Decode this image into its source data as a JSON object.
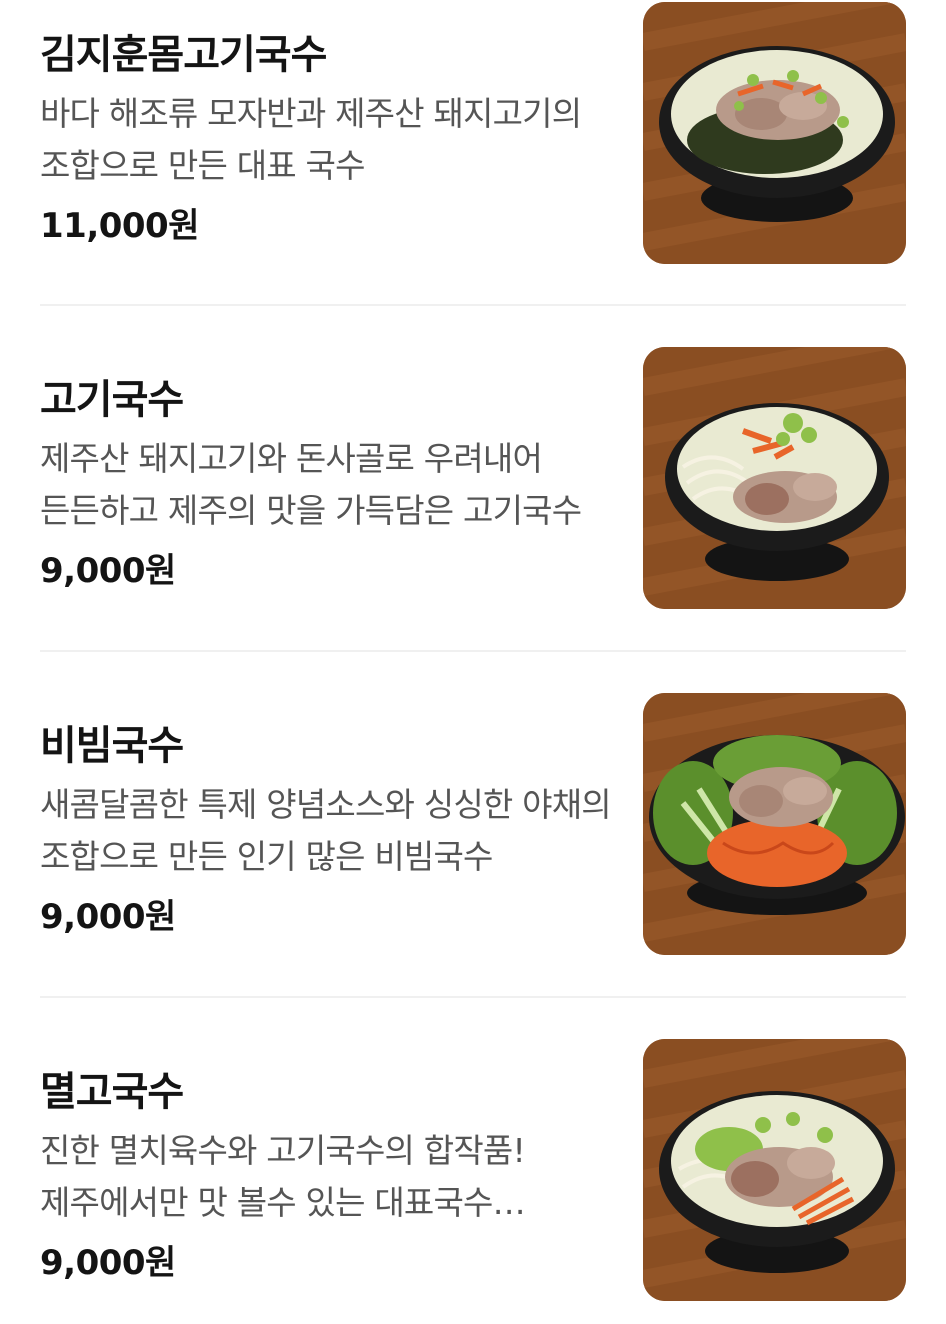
{
  "menu": {
    "items": [
      {
        "name": "김지훈몸고기국수",
        "description": "바다 해조류 모자반과 제주산 돼지고기의 조합으로 만든 대표 국수",
        "price": "11,000원",
        "image": "momguksu-photo"
      },
      {
        "name": "고기국수",
        "description": "제주산 돼지고기와 돈사골로 우려내어 든든하고 제주의 맛을 가득담은 고기국수",
        "price": "9,000원",
        "image": "gogiguksu-photo"
      },
      {
        "name": "비빔국수",
        "description": "새콤달콤한 특제 양념소스와 싱싱한 야채의 조합으로 만든 인기 많은 비빔국수",
        "price": "9,000원",
        "image": "bibimguksu-photo"
      },
      {
        "name": "멸고국수",
        "description": "진한 멸치육수와 고기국수의 합작품! 제주에서만 맛 볼수 있는 대표국수 추천메뉴",
        "price": "9,000원",
        "image": "myeolgoguksu-photo"
      }
    ]
  },
  "colors": {
    "wood": "#8a4e22",
    "bowl": "#1b1b1b",
    "broth": "#e9ead2",
    "pork": "#b89a8a",
    "scallion": "#8fc04a",
    "carrot": "#e8652a",
    "seaweed": "#2f3a1e",
    "lettuce": "#5b8f2c"
  }
}
